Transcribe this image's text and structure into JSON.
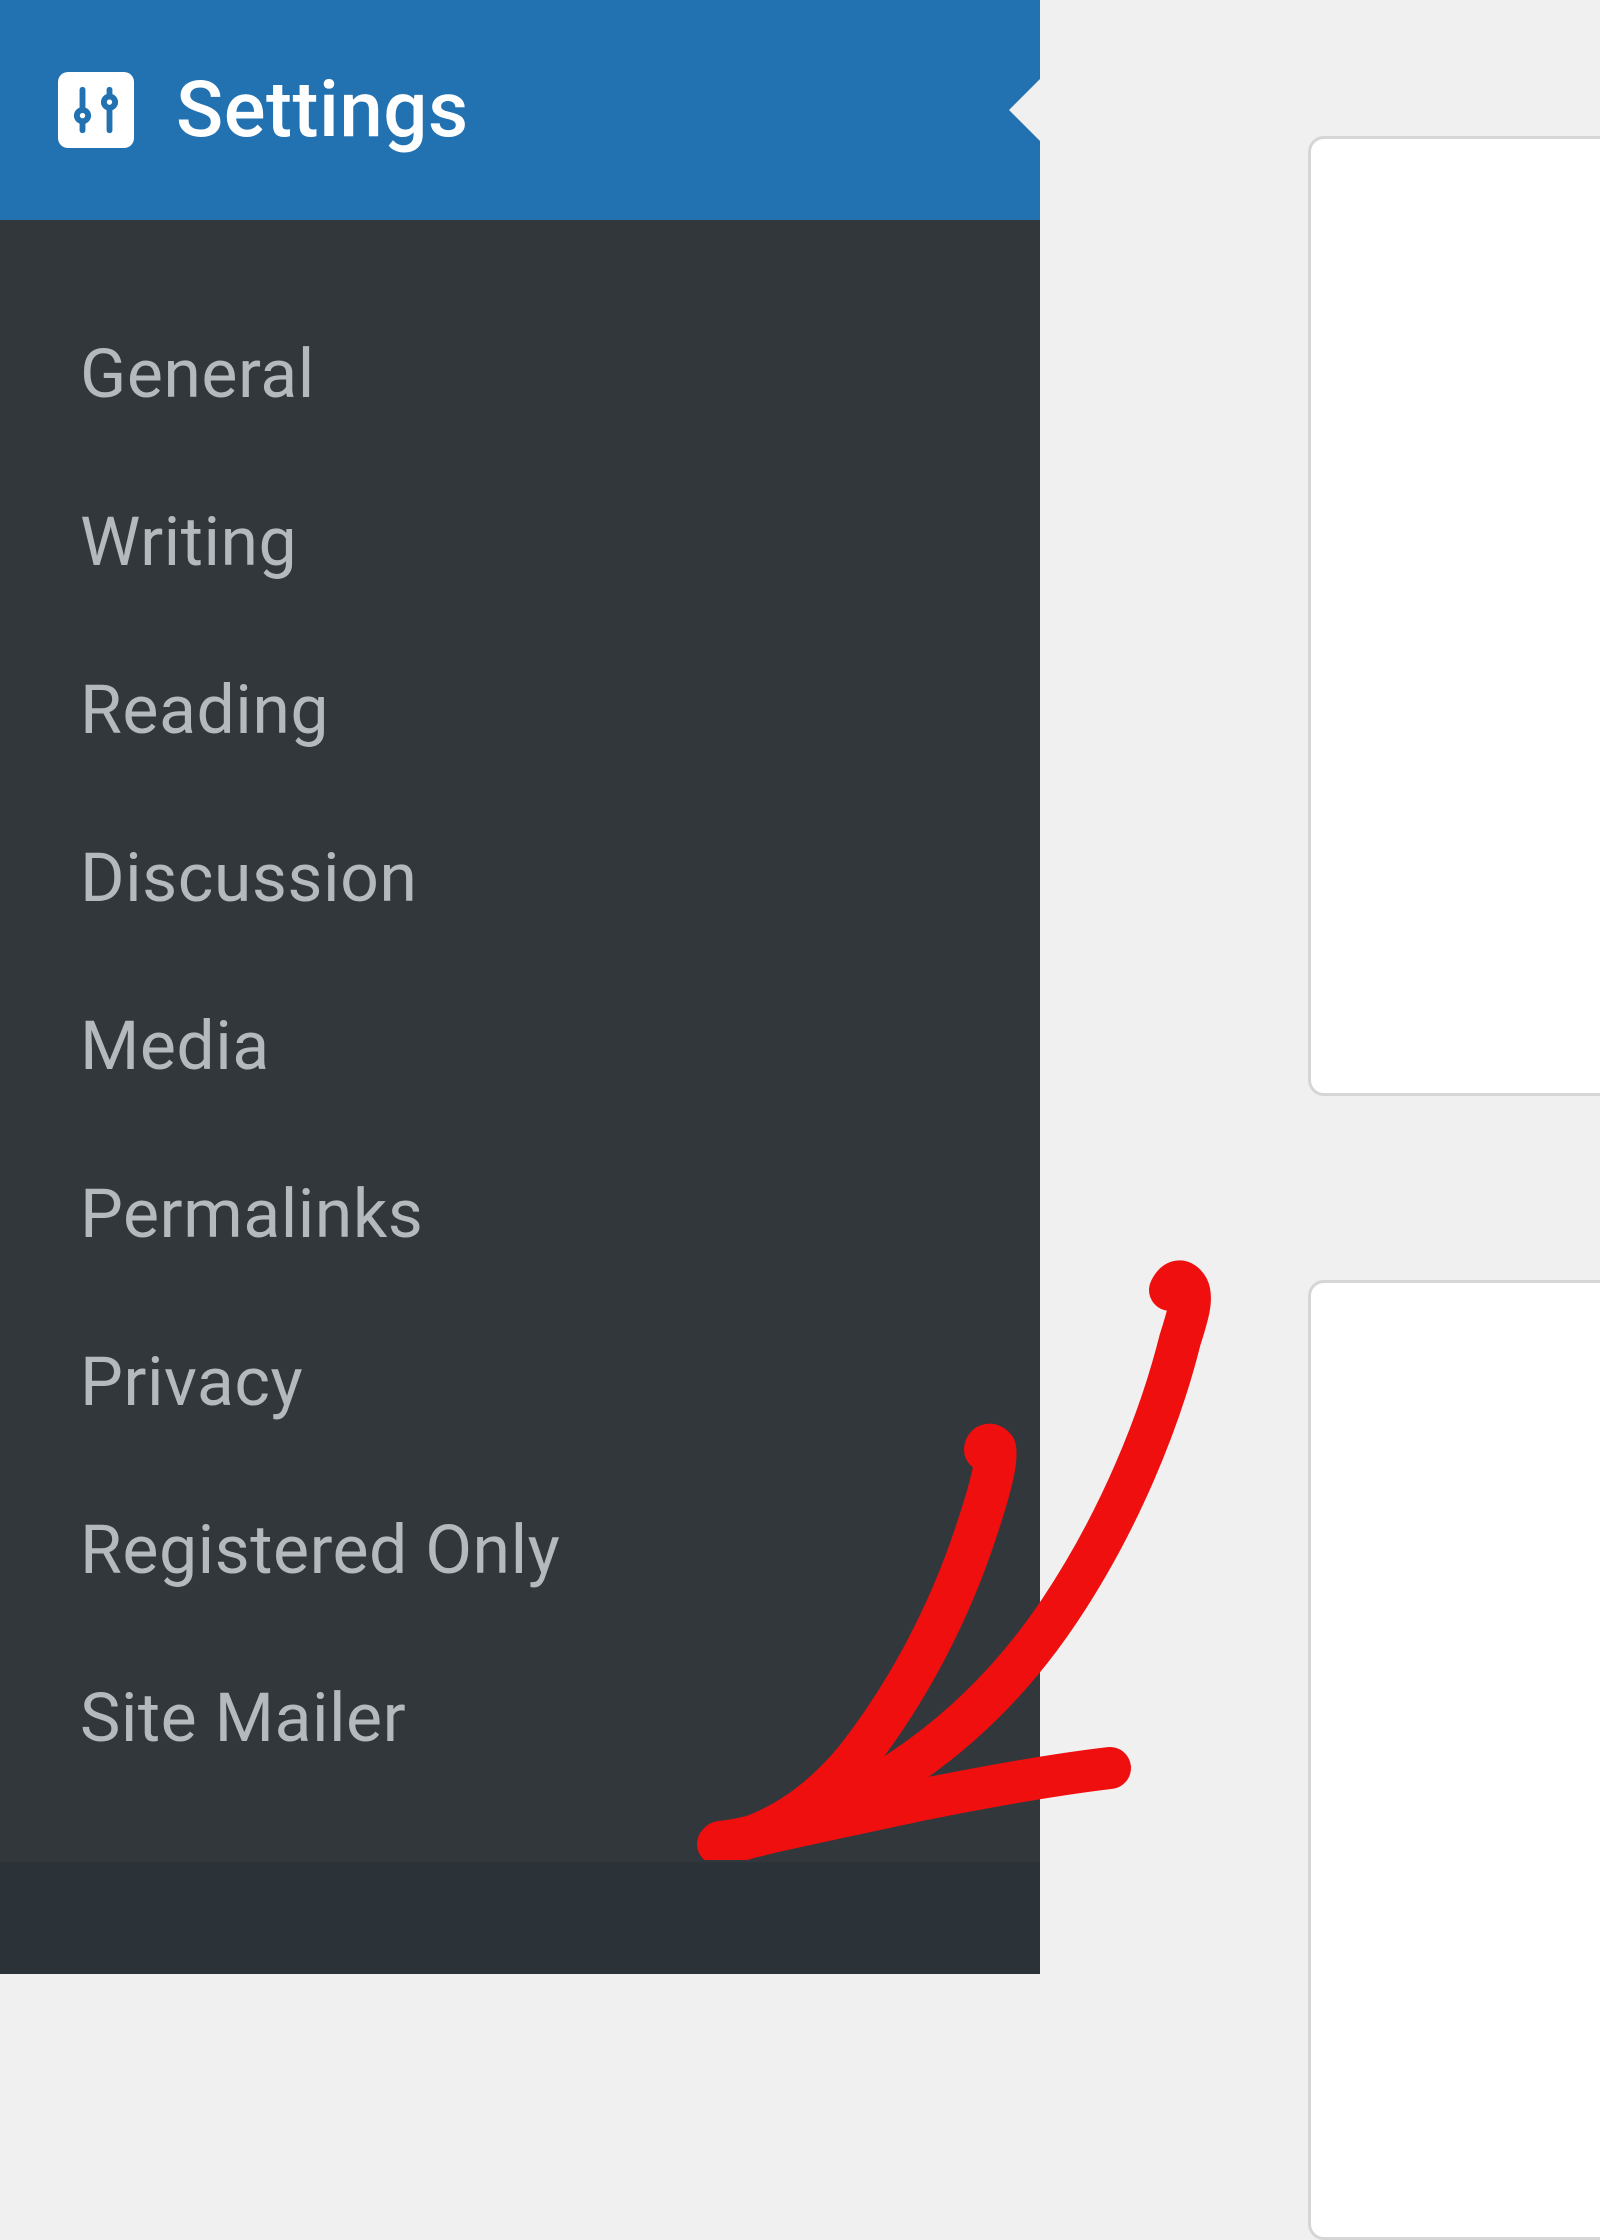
{
  "sidebar": {
    "header": {
      "label": "Settings",
      "icon_name": "sliders-icon"
    },
    "items": [
      {
        "label": "General"
      },
      {
        "label": "Writing"
      },
      {
        "label": "Reading"
      },
      {
        "label": "Discussion"
      },
      {
        "label": "Media"
      },
      {
        "label": "Permalinks"
      },
      {
        "label": "Privacy"
      },
      {
        "label": "Registered Only"
      },
      {
        "label": "Site Mailer"
      }
    ]
  },
  "colors": {
    "sidebar_bg": "#2c3338",
    "submenu_bg": "#32373c",
    "header_bg": "#2271b1",
    "text_light": "#b4b9be",
    "annotation": "#ef0f0f"
  }
}
